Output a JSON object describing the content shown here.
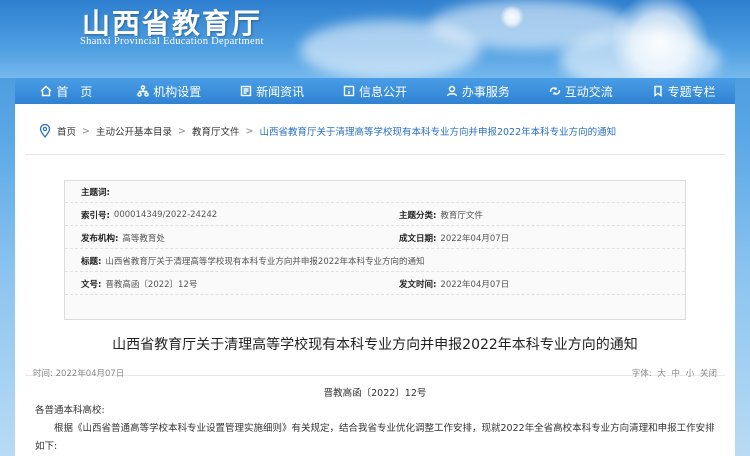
{
  "header": {
    "title_cn": "山西省教育厅",
    "title_en": "Shanxi Provincial Education Department"
  },
  "nav": [
    {
      "label": "首　页",
      "icon": "home-icon"
    },
    {
      "label": "机构设置",
      "icon": "org-icon"
    },
    {
      "label": "新闻资讯",
      "icon": "news-icon"
    },
    {
      "label": "信息公开",
      "icon": "info-icon"
    },
    {
      "label": "办事服务",
      "icon": "service-icon"
    },
    {
      "label": "互动交流",
      "icon": "interact-icon"
    },
    {
      "label": "专题专栏",
      "icon": "topic-icon"
    }
  ],
  "breadcrumb": {
    "home": "首页",
    "level1": "主动公开基本目录",
    "level2": "教育厅文件",
    "current": "山西省教育厅关于清理高等学校现有本科专业方向并申报2022年本科专业方向的通知",
    "sep": ">"
  },
  "meta": {
    "topic_label": "主题词:",
    "topic_value": "",
    "index_label": "索引号:",
    "index_value": "000014349/2022-24242",
    "category_label": "主题分类:",
    "category_value": "教育厅文件",
    "publisher_label": "发布机构:",
    "publisher_value": "高等教育处",
    "created_label": "成文日期:",
    "created_value": "2022年04月07日",
    "subject_label": "标题:",
    "subject_value": "山西省教育厅关于清理高等学校现有本科专业方向并申报2022年本科专业方向的通知",
    "docno_label": "文号:",
    "docno_value": "晋教高函〔2022〕12号",
    "published_label": "发文时间:",
    "published_value": "2022年04月07日"
  },
  "article": {
    "title": "山西省教育厅关于清理高等学校现有本科专业方向并申报2022年本科专业方向的通知",
    "time": "时间: 2022年04月07日",
    "font_label": "字体:",
    "font_large": "大",
    "font_medium": "中",
    "font_small": "小",
    "close": "关闭",
    "doc_number": "晋教高函〔2022〕12号",
    "greeting": "各普通本科高校:",
    "para1_line1": "根据《山西省普通高等学校本科专业设置管理实施细则》有关规定，结合我省专业优化调整工作安排，现就2022年全省高校本科专业方向清理和申报工作安排",
    "para1_line2": "如下:"
  }
}
